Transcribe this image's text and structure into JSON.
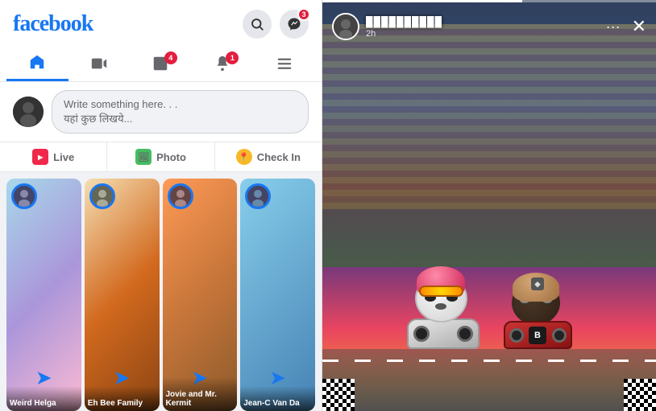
{
  "left": {
    "logo": "facebook",
    "header_icons": [
      {
        "name": "search",
        "badge": null
      },
      {
        "name": "messenger",
        "badge": "3"
      }
    ],
    "nav_tabs": [
      {
        "id": "home",
        "label": "Home",
        "active": true,
        "badge": null
      },
      {
        "id": "video",
        "label": "Video",
        "active": false,
        "badge": null
      },
      {
        "id": "marketplace",
        "label": "Marketplace",
        "active": false,
        "badge": "4"
      },
      {
        "id": "notifications",
        "label": "Notifications",
        "active": false,
        "badge": "1"
      },
      {
        "id": "menu",
        "label": "Menu",
        "active": false,
        "badge": null
      }
    ],
    "post_box": {
      "placeholder_line1": "Write something here. . .",
      "placeholder_line2": "यहां कुछ लिखये..."
    },
    "action_buttons": [
      {
        "id": "live",
        "label": "Live"
      },
      {
        "id": "photo",
        "label": "Photo"
      },
      {
        "id": "checkin",
        "label": "Check In"
      }
    ],
    "stories": [
      {
        "id": 1,
        "label": "Weird Helga",
        "color": "story-bg-1"
      },
      {
        "id": 2,
        "label": "Eh Bee Family",
        "color": "story-bg-2"
      },
      {
        "id": 3,
        "label": "Jovie and Mr. Kermit",
        "color": "story-bg-3"
      },
      {
        "id": 4,
        "label": "Jean-C Van Da",
        "color": "story-bg-4"
      }
    ]
  },
  "right": {
    "story": {
      "username_masked": "██████████",
      "time": "2h",
      "progress": 60
    }
  }
}
